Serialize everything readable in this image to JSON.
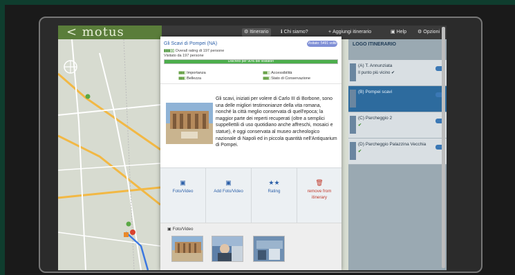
{
  "app": {
    "logo": "< motus"
  },
  "topbar": {
    "items": [
      {
        "icon": "globe-icon",
        "glyph": "⚙",
        "label": "Itinerario"
      },
      {
        "icon": "info-icon",
        "glyph": "ℹ",
        "label": "Chi siamo?"
      },
      {
        "icon": "plus-icon",
        "glyph": "+",
        "label": "Aggiungi itinerario"
      },
      {
        "icon": "help-icon",
        "glyph": "▣",
        "label": "Help"
      },
      {
        "icon": "gear-icon",
        "glyph": "⚙",
        "label": "Opzioni"
      }
    ]
  },
  "popup": {
    "title": "Gli Scavi di Pompei (NA)",
    "pill": "Visitato: 5491 volte",
    "stats_line1": "Overall rating di 197 persone",
    "stats_line2": "Visitato da 197 persone",
    "progress_label": "Discreto per 90% dei visitatori",
    "progress_fraction": 1.0,
    "indicators": [
      "Importanza",
      "Accessibilità",
      "Bellezza",
      "Stato di Conservazione"
    ],
    "description": "Gli scavi, iniziati per volere di Carlo III di Borbone, sono una delle migliori testimonianze della vita romana, nonché la città meglio conservata di quell'epoca; la maggior parte dei reperti recuperati (oltre a semplici suppellettili di uso quotidiano anche affreschi, mosaici e statue), è oggi conservata al museo archeologico nazionale di Napoli ed in piccola quantità nell'Antiquarium di Pompei.",
    "actions": [
      {
        "icon": "photo-icon",
        "glyph": "▣",
        "label": "Foto/Video",
        "danger": false
      },
      {
        "icon": "add-photo-icon",
        "glyph": "▣",
        "label": "Add Foto/Video",
        "danger": false
      },
      {
        "icon": "star-icon",
        "glyph": "★★",
        "label": "Rating",
        "danger": false
      },
      {
        "icon": "trash-icon",
        "glyph": "🗑",
        "label": "remove from itinerary",
        "danger": true
      }
    ],
    "media_title": "Foto/Video"
  },
  "itinerary": {
    "title": "LOGO ITINERARIO",
    "rows": [
      {
        "label": "(A) T. Annunziata",
        "sub": "Il punto più vicino ✔",
        "selected": false
      },
      {
        "label": "(B) Pompei scavi",
        "sub": "",
        "selected": true
      },
      {
        "label": "(C) Parcheggio 2",
        "sub": "✔",
        "selected": false
      },
      {
        "label": "(D) Parcheggio Palazzina Vecchia",
        "sub": "✔",
        "selected": false
      }
    ]
  },
  "colors": {
    "brand": "#5a7d3a",
    "link": "#2b5fa8",
    "progress": "#4cae4c",
    "danger": "#c0392b",
    "selected_row": "#2d6b9e"
  }
}
